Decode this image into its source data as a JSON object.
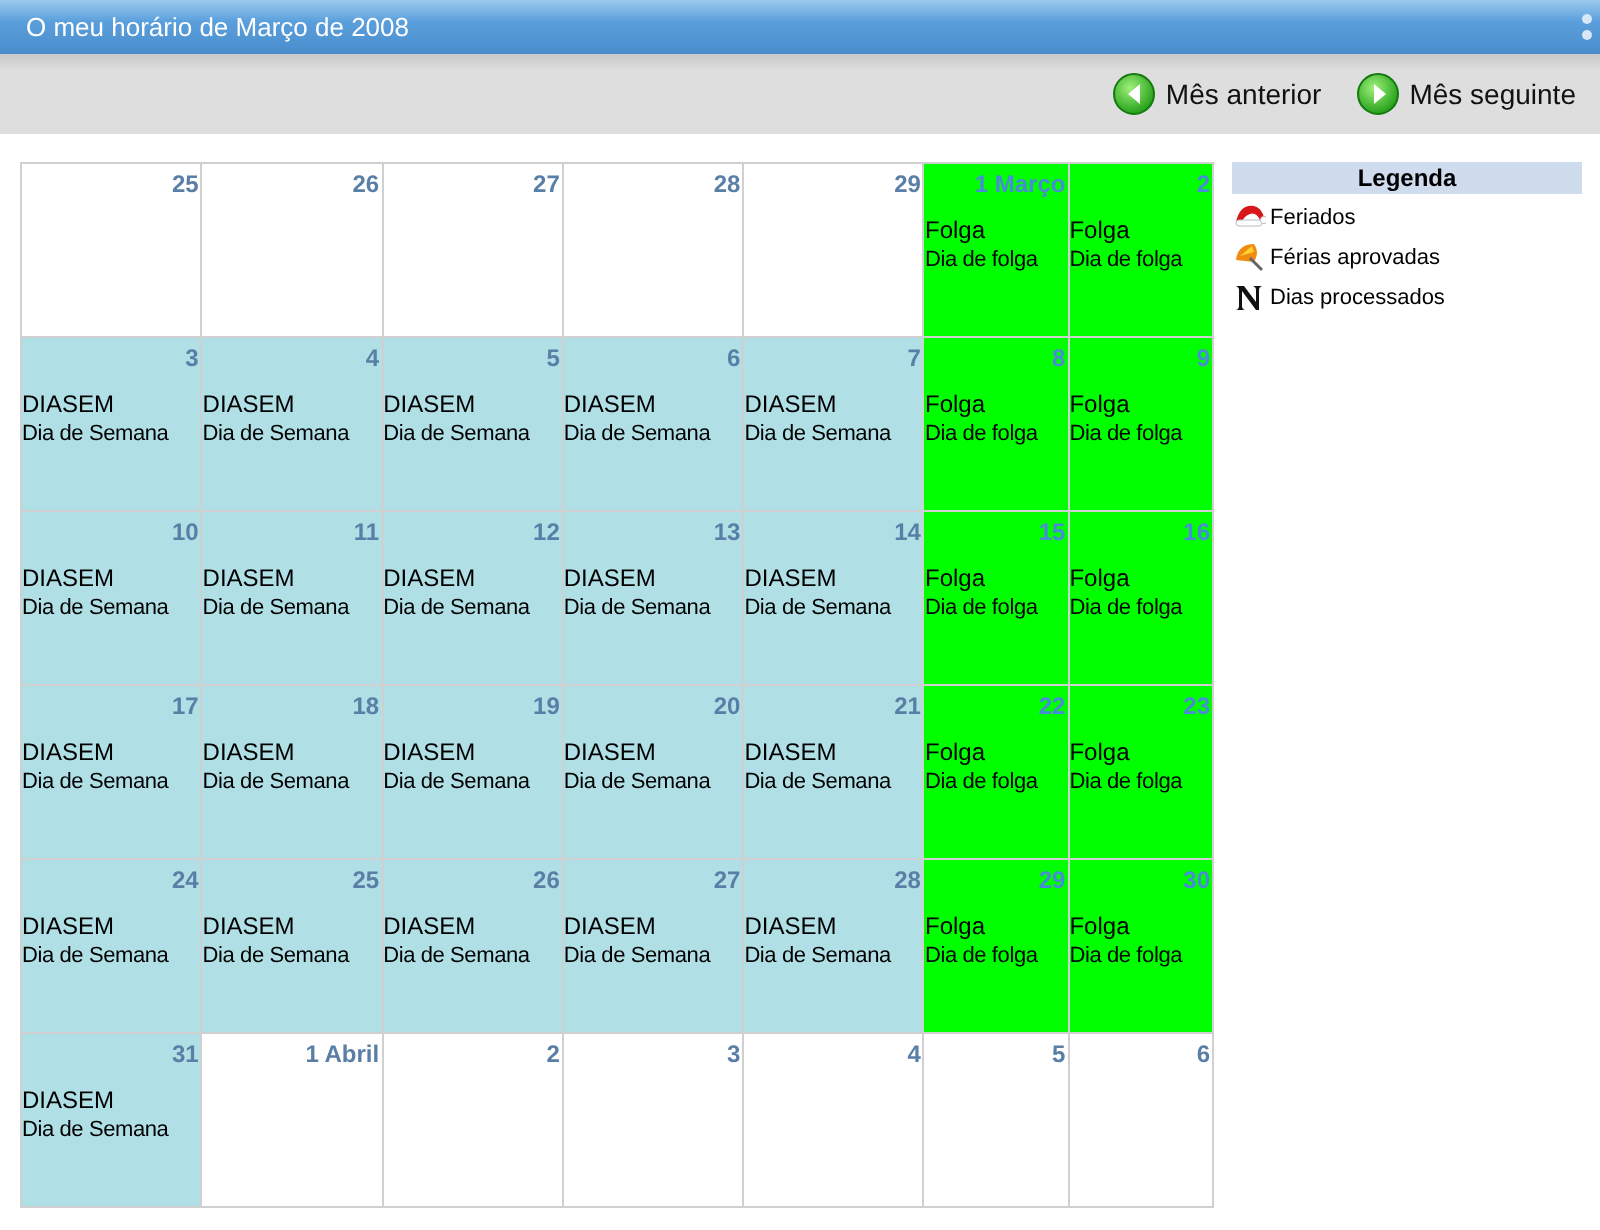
{
  "window": {
    "title": "O meu horário de Março de 2008"
  },
  "toolbar": {
    "buttons": [
      {
        "label": "Mês anterior",
        "kind": "prev"
      },
      {
        "label": "Mês seguinte",
        "kind": "next"
      }
    ]
  },
  "calendar": {
    "weeks": [
      [
        {
          "day": "25",
          "kind": "empty"
        },
        {
          "day": "26",
          "kind": "empty"
        },
        {
          "day": "27",
          "kind": "empty"
        },
        {
          "day": "28",
          "kind": "empty"
        },
        {
          "day": "29",
          "kind": "empty"
        },
        {
          "day": "1 Março",
          "kind": "off",
          "title": "Folga",
          "subtitle": "Dia de folga"
        },
        {
          "day": "2",
          "kind": "off",
          "title": "Folga",
          "subtitle": "Dia de folga"
        }
      ],
      [
        {
          "day": "3",
          "kind": "work",
          "title": "DIASEM",
          "subtitle": "Dia de Semana"
        },
        {
          "day": "4",
          "kind": "work",
          "title": "DIASEM",
          "subtitle": "Dia de Semana"
        },
        {
          "day": "5",
          "kind": "work",
          "title": "DIASEM",
          "subtitle": "Dia de Semana"
        },
        {
          "day": "6",
          "kind": "work",
          "title": "DIASEM",
          "subtitle": "Dia de Semana"
        },
        {
          "day": "7",
          "kind": "work",
          "title": "DIASEM",
          "subtitle": "Dia de Semana"
        },
        {
          "day": "8",
          "kind": "off",
          "title": "Folga",
          "subtitle": "Dia de folga"
        },
        {
          "day": "9",
          "kind": "off",
          "title": "Folga",
          "subtitle": "Dia de folga"
        }
      ],
      [
        {
          "day": "10",
          "kind": "work",
          "title": "DIASEM",
          "subtitle": "Dia de Semana"
        },
        {
          "day": "11",
          "kind": "work",
          "title": "DIASEM",
          "subtitle": "Dia de Semana"
        },
        {
          "day": "12",
          "kind": "work",
          "title": "DIASEM",
          "subtitle": "Dia de Semana"
        },
        {
          "day": "13",
          "kind": "work",
          "title": "DIASEM",
          "subtitle": "Dia de Semana"
        },
        {
          "day": "14",
          "kind": "work",
          "title": "DIASEM",
          "subtitle": "Dia de Semana"
        },
        {
          "day": "15",
          "kind": "off",
          "title": "Folga",
          "subtitle": "Dia de folga"
        },
        {
          "day": "16",
          "kind": "off",
          "title": "Folga",
          "subtitle": "Dia de folga"
        }
      ],
      [
        {
          "day": "17",
          "kind": "work",
          "title": "DIASEM",
          "subtitle": "Dia de Semana"
        },
        {
          "day": "18",
          "kind": "work",
          "title": "DIASEM",
          "subtitle": "Dia de Semana"
        },
        {
          "day": "19",
          "kind": "work",
          "title": "DIASEM",
          "subtitle": "Dia de Semana"
        },
        {
          "day": "20",
          "kind": "work",
          "title": "DIASEM",
          "subtitle": "Dia de Semana"
        },
        {
          "day": "21",
          "kind": "work",
          "title": "DIASEM",
          "subtitle": "Dia de Semana"
        },
        {
          "day": "22",
          "kind": "off",
          "title": "Folga",
          "subtitle": "Dia de folga"
        },
        {
          "day": "23",
          "kind": "off",
          "title": "Folga",
          "subtitle": "Dia de folga"
        }
      ],
      [
        {
          "day": "24",
          "kind": "work",
          "title": "DIASEM",
          "subtitle": "Dia de Semana"
        },
        {
          "day": "25",
          "kind": "work",
          "title": "DIASEM",
          "subtitle": "Dia de Semana"
        },
        {
          "day": "26",
          "kind": "work",
          "title": "DIASEM",
          "subtitle": "Dia de Semana"
        },
        {
          "day": "27",
          "kind": "work",
          "title": "DIASEM",
          "subtitle": "Dia de Semana"
        },
        {
          "day": "28",
          "kind": "work",
          "title": "DIASEM",
          "subtitle": "Dia de Semana"
        },
        {
          "day": "29",
          "kind": "off",
          "title": "Folga",
          "subtitle": "Dia de folga"
        },
        {
          "day": "30",
          "kind": "off",
          "title": "Folga",
          "subtitle": "Dia de folga"
        }
      ],
      [
        {
          "day": "31",
          "kind": "work",
          "title": "DIASEM",
          "subtitle": "Dia de Semana"
        },
        {
          "day": "1 Abril",
          "kind": "empty"
        },
        {
          "day": "2",
          "kind": "empty"
        },
        {
          "day": "3",
          "kind": "empty"
        },
        {
          "day": "4",
          "kind": "empty"
        },
        {
          "day": "5",
          "kind": "empty"
        },
        {
          "day": "6",
          "kind": "empty"
        }
      ]
    ]
  },
  "legend": {
    "title": "Legenda",
    "items": [
      {
        "label": "Feriados",
        "kind": "holiday"
      },
      {
        "label": "Férias aprovadas",
        "kind": "vacation"
      },
      {
        "label": "Dias processados",
        "kind": "processed"
      }
    ]
  }
}
